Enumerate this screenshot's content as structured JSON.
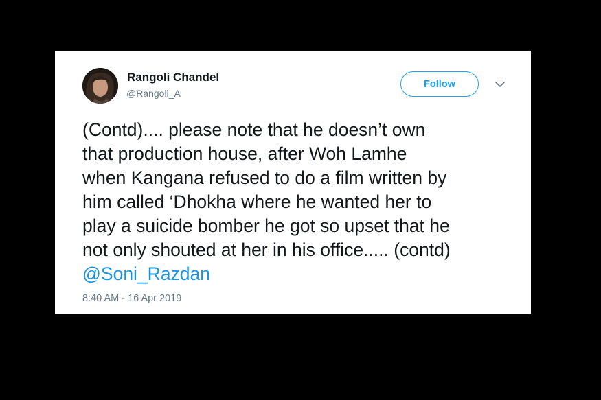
{
  "tweet": {
    "author": {
      "display_name": "Rangoli Chandel",
      "handle": "@Rangoli_A",
      "avatar_icon": "profile-photo"
    },
    "follow_label": "Follow",
    "menu_icon": "chevron-down-icon",
    "text_lines": [
      "(Contd).... please note that he doesn’t own",
      "that production house, after Woh Lamhe",
      "when Kangana refused to do a film written by",
      "him called ‘Dhokha where he wanted her to",
      "play a suicide bomber he got so upset that he",
      "not only shouted at her in his office..... (contd)"
    ],
    "mention": "@Soni_Razdan",
    "timestamp": "8:40 AM - 16 Apr 2019"
  },
  "colors": {
    "page_background": "#000000",
    "card_background": "#ffffff",
    "accent": "#1da1f2",
    "mention": "#1b95e0",
    "text": "#14171a",
    "muted": "#657786"
  }
}
